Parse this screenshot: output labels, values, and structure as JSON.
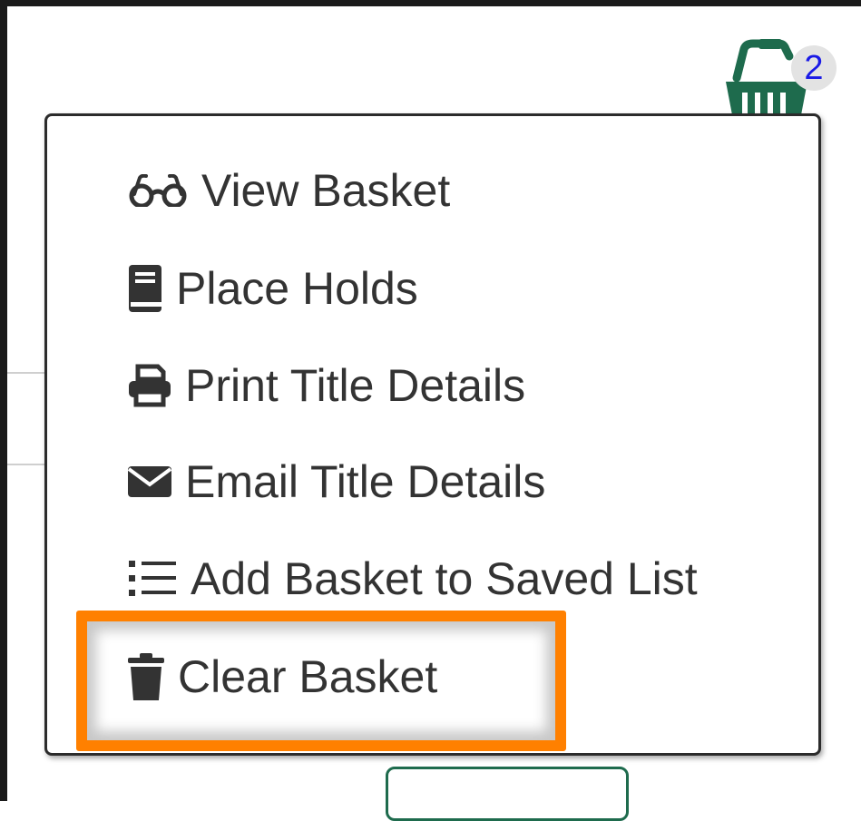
{
  "header": {
    "basket": {
      "icon": "basket-icon",
      "count": "2",
      "color": "#1e6b4d",
      "badge_text_color": "#1a1ae6"
    }
  },
  "basket_menu": {
    "items": [
      {
        "label": "View Basket",
        "icon": "glasses-icon"
      },
      {
        "label": "Place Holds",
        "icon": "book-icon"
      },
      {
        "label": "Print Title Details",
        "icon": "print-icon"
      },
      {
        "label": "Email Title Details",
        "icon": "envelope-icon"
      },
      {
        "label": "Add Basket to Saved List",
        "icon": "list-icon"
      },
      {
        "label": "Clear Basket",
        "icon": "trash-icon"
      }
    ],
    "highlighted_item": "Clear Basket",
    "highlight_color": "#ff8000"
  }
}
